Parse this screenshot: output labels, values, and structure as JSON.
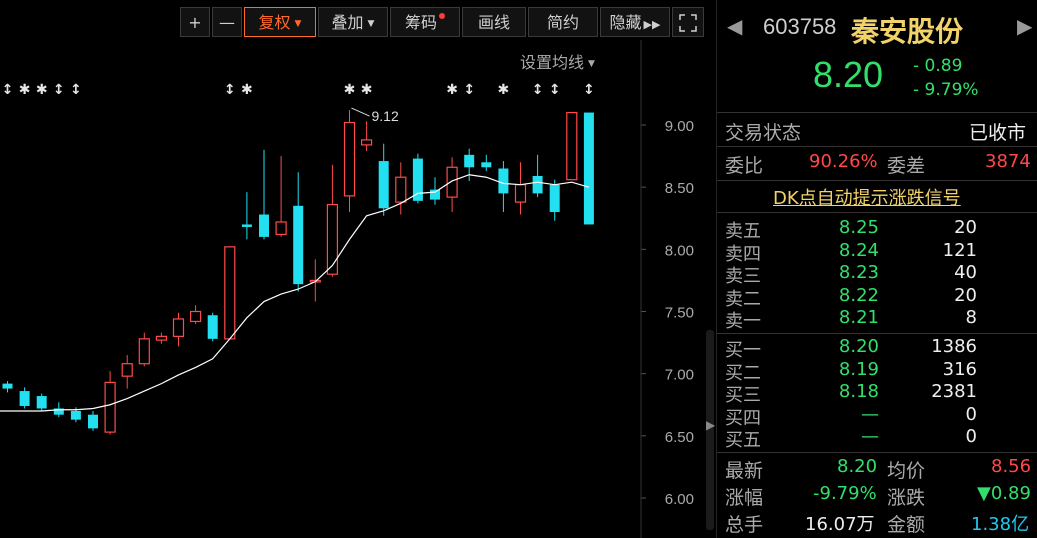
{
  "toolbar": {
    "zoom_in": "+",
    "zoom_out": "—",
    "restore_rights": "复权",
    "overlay": "叠加",
    "chips": "筹码",
    "draw_line": "画线",
    "simple": "简约",
    "hide": "隐藏",
    "ma_settings": "设置均线"
  },
  "chart_data": {
    "type": "candlestick",
    "y_ticks": [
      "9.00",
      "8.50",
      "8.00",
      "7.50",
      "7.00",
      "6.50",
      "6.00"
    ],
    "ylim": [
      5.8,
      9.25
    ],
    "annotation": "9.12",
    "up_color": "#ff4a4a",
    "down_color": "#22e0f0",
    "ma_color": "#ffffff",
    "candles": [
      {
        "o": 6.92,
        "c": 6.88,
        "h": 6.94,
        "l": 6.85
      },
      {
        "o": 6.86,
        "c": 6.74,
        "h": 6.89,
        "l": 6.72
      },
      {
        "o": 6.82,
        "c": 6.72,
        "h": 6.84,
        "l": 6.7
      },
      {
        "o": 6.72,
        "c": 6.67,
        "h": 6.77,
        "l": 6.65
      },
      {
        "o": 6.7,
        "c": 6.63,
        "h": 6.73,
        "l": 6.61
      },
      {
        "o": 6.67,
        "c": 6.56,
        "h": 6.7,
        "l": 6.54
      },
      {
        "o": 6.53,
        "c": 6.93,
        "h": 7.02,
        "l": 6.51
      },
      {
        "o": 6.98,
        "c": 7.08,
        "h": 7.15,
        "l": 6.88
      },
      {
        "o": 7.08,
        "c": 7.28,
        "h": 7.33,
        "l": 7.06
      },
      {
        "o": 7.27,
        "c": 7.3,
        "h": 7.33,
        "l": 7.24
      },
      {
        "o": 7.3,
        "c": 7.44,
        "h": 7.49,
        "l": 7.22
      },
      {
        "o": 7.42,
        "c": 7.5,
        "h": 7.55,
        "l": 7.4
      },
      {
        "o": 7.47,
        "c": 7.28,
        "h": 7.49,
        "l": 7.26
      },
      {
        "o": 7.28,
        "c": 8.02,
        "h": 8.02,
        "l": 7.28
      },
      {
        "o": 8.2,
        "c": 8.18,
        "h": 8.46,
        "l": 8.08
      },
      {
        "o": 8.28,
        "c": 8.1,
        "h": 8.8,
        "l": 8.08
      },
      {
        "o": 8.12,
        "c": 8.22,
        "h": 8.75,
        "l": 8.1
      },
      {
        "o": 8.35,
        "c": 7.72,
        "h": 8.62,
        "l": 7.66
      },
      {
        "o": 7.75,
        "c": 7.75,
        "h": 7.92,
        "l": 7.58
      },
      {
        "o": 7.8,
        "c": 8.36,
        "h": 8.68,
        "l": 7.78
      },
      {
        "o": 8.43,
        "c": 9.02,
        "h": 9.12,
        "l": 8.3
      },
      {
        "o": 8.84,
        "c": 8.88,
        "h": 9.03,
        "l": 8.79
      },
      {
        "o": 8.71,
        "c": 8.33,
        "h": 8.85,
        "l": 8.27
      },
      {
        "o": 8.38,
        "c": 8.58,
        "h": 8.7,
        "l": 8.28
      },
      {
        "o": 8.73,
        "c": 8.39,
        "h": 8.77,
        "l": 8.37
      },
      {
        "o": 8.48,
        "c": 8.4,
        "h": 8.58,
        "l": 8.36
      },
      {
        "o": 8.42,
        "c": 8.66,
        "h": 8.74,
        "l": 8.3
      },
      {
        "o": 8.76,
        "c": 8.66,
        "h": 8.81,
        "l": 8.55
      },
      {
        "o": 8.7,
        "c": 8.66,
        "h": 8.76,
        "l": 8.63
      },
      {
        "o": 8.65,
        "c": 8.45,
        "h": 8.71,
        "l": 8.3
      },
      {
        "o": 8.38,
        "c": 8.52,
        "h": 8.7,
        "l": 8.28
      },
      {
        "o": 8.59,
        "c": 8.45,
        "h": 8.76,
        "l": 8.42
      },
      {
        "o": 8.52,
        "c": 8.3,
        "h": 8.56,
        "l": 8.23
      },
      {
        "o": 8.56,
        "c": 9.1,
        "h": 9.1,
        "l": 8.56
      },
      {
        "o": 9.1,
        "c": 8.2,
        "h": 9.1,
        "l": 8.2
      }
    ],
    "ma": [
      6.7,
      6.7,
      6.7,
      6.71,
      6.71,
      6.72,
      6.75,
      6.8,
      6.86,
      6.92,
      6.99,
      7.05,
      7.12,
      7.28,
      7.45,
      7.58,
      7.64,
      7.68,
      7.74,
      7.87,
      8.08,
      8.27,
      8.31,
      8.37,
      8.45,
      8.46,
      8.55,
      8.6,
      8.58,
      8.53,
      8.52,
      8.54,
      8.52,
      8.54,
      8.5
    ],
    "markers": [
      "↕",
      "✱",
      "✱",
      "↕",
      "↕",
      "",
      "",
      "",
      "",
      "",
      "",
      "",
      "",
      "↕",
      "✱",
      "",
      "",
      "",
      "",
      "",
      "✱",
      "✱",
      "",
      "",
      "",
      "",
      "✱",
      "↕",
      "",
      "✱",
      "",
      "↕",
      "↕",
      "",
      "↕"
    ]
  },
  "panel": {
    "code": "603758",
    "name": "秦安股份",
    "price": "8.20",
    "change": "- 0.89",
    "change_pct": "- 9.79%",
    "status_label": "交易状态",
    "status_value": "已收市",
    "ratio_label": "委比",
    "ratio_value": "90.26%",
    "diff_label": "委差",
    "diff_value": "3874",
    "signal_link": "DK点自动提示涨跌信号",
    "sells": [
      {
        "label": "卖五",
        "price": "8.25",
        "vol": "20"
      },
      {
        "label": "卖四",
        "price": "8.24",
        "vol": "121"
      },
      {
        "label": "卖三",
        "price": "8.23",
        "vol": "40"
      },
      {
        "label": "卖二",
        "price": "8.22",
        "vol": "20"
      },
      {
        "label": "卖一",
        "price": "8.21",
        "vol": "8"
      }
    ],
    "buys": [
      {
        "label": "买一",
        "price": "8.20",
        "vol": "1386"
      },
      {
        "label": "买二",
        "price": "8.19",
        "vol": "316"
      },
      {
        "label": "买三",
        "price": "8.18",
        "vol": "2381"
      },
      {
        "label": "买四",
        "price": "—",
        "vol": "0"
      },
      {
        "label": "买五",
        "price": "—",
        "vol": "0"
      }
    ],
    "stats": {
      "latest_label": "最新",
      "latest": "8.20",
      "avg_label": "均价",
      "avg": "8.56",
      "pct_label": "涨幅",
      "pct": "-9.79%",
      "chg_label": "涨跌",
      "chg": "▼0.89",
      "vol_label": "总手",
      "vol": "16.07万",
      "amt_label": "金额",
      "amt": "1.38亿"
    }
  }
}
